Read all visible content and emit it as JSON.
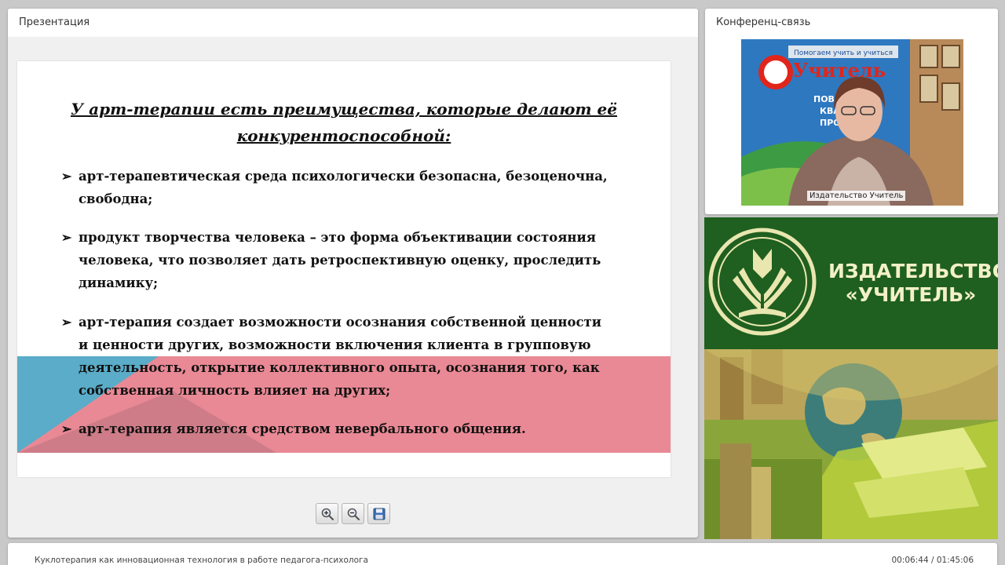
{
  "presentation": {
    "title": "Презентация",
    "slide": {
      "heading_line1": "У арт-терапии есть преимущества, которые делают её",
      "heading_line2": "конкурентоспособной:",
      "bullet_mark": "➢",
      "bullets": [
        "арт-терапевтическая среда психологически безопасна, безоценочна, свободна;",
        "продукт творчества человека – это форма объективации состояния человека, что позволяет дать ретроспективную оценку, проследить динамику;",
        "арт-терапия создает возможности осознания собственной ценности и ценности других, возможности включения клиента в групповую деятельность, открытие коллективного опыта, осознания того, как собственная личность влияет на других;",
        "арт-терапия является средством невербального общения."
      ]
    },
    "tools": [
      "zoom-in-icon",
      "zoom-out-icon",
      "save-icon"
    ]
  },
  "conference": {
    "title": "Конференц-связь",
    "video_label": "Издательство Учитель",
    "banner_lines": [
      "Помогаем учить и учиться",
      "Учитель",
      "ПОВЫШ",
      "КВАЛ",
      "ПРОФ"
    ]
  },
  "brand": {
    "line1": "ИЗДАТЕЛЬСТВО",
    "line2": "«УЧИТЕЛЬ»"
  },
  "footer": {
    "title": "Куклотерапия как инновационная технология в работе  педагога-психолога",
    "time": "00:06:44 / 01:45:06"
  }
}
